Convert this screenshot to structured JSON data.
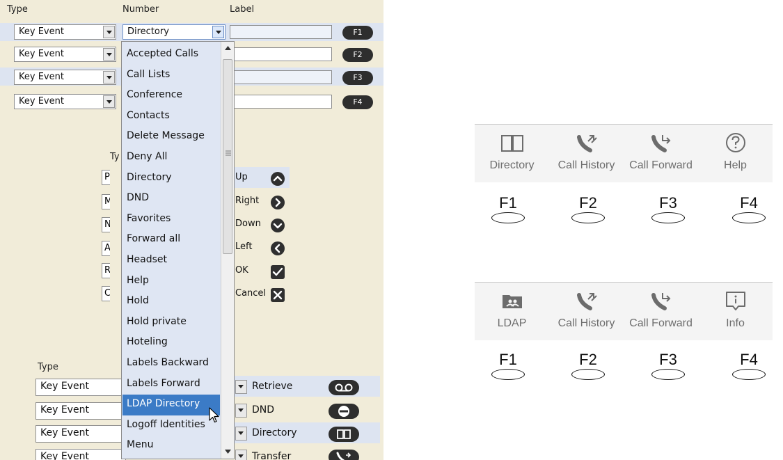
{
  "config": {
    "headers": {
      "type": "Type",
      "number": "Number",
      "label": "Label"
    },
    "top_rows": [
      {
        "type": "Key Event",
        "number": "Directory",
        "fkey": "F1"
      },
      {
        "type": "Key Event",
        "fkey": "F2"
      },
      {
        "type": "Key Event",
        "fkey": "F3"
      },
      {
        "type": "Key Event",
        "fkey": "F4"
      }
    ],
    "nav_section": {
      "type_header_fragment": "Ty",
      "stub_letters": [
        "P",
        "M",
        "N",
        "A",
        "R",
        "C"
      ],
      "labels": [
        "Up",
        "Right",
        "Down",
        "Left",
        "OK",
        "Cancel"
      ],
      "icons": [
        "chevron-up-icon",
        "chevron-right-icon",
        "chevron-down-icon",
        "chevron-left-icon",
        "checkmark-icon",
        "x-mark-icon"
      ]
    },
    "bottom_section": {
      "type_header": "Type",
      "rows": [
        {
          "type": "Key Event",
          "label": "Retrieve",
          "icon": "voicemail-icon"
        },
        {
          "type": "Key Event",
          "label": "DND",
          "icon": "minus-circle-icon"
        },
        {
          "type": "Key Event",
          "label": "Directory",
          "icon": "book-icon"
        },
        {
          "type": "Key Event",
          "label": "Transfer",
          "icon": "phone-forward-icon"
        }
      ]
    },
    "dropdown": {
      "options": [
        "Accepted Calls",
        "Call Lists",
        "Conference",
        "Contacts",
        "Delete Message",
        "Deny All",
        "Directory",
        "DND",
        "Favorites",
        "Forward all",
        "Headset",
        "Help",
        "Hold",
        "Hold private",
        "Hoteling",
        "Labels Backward",
        "Labels Forward",
        "LDAP Directory",
        "Logoff Identities",
        "Menu"
      ],
      "selected": "LDAP Directory"
    }
  },
  "phone": {
    "screen1": {
      "softkeys": [
        {
          "label": "Directory",
          "icon": "book-icon"
        },
        {
          "label": "Call History",
          "icon": "call-history-icon"
        },
        {
          "label": "Call Forward",
          "icon": "call-forward-icon"
        },
        {
          "label": "Help",
          "icon": "help-icon"
        }
      ],
      "fkeys": [
        "F1",
        "F2",
        "F3",
        "F4"
      ]
    },
    "screen2": {
      "softkeys": [
        {
          "label": "LDAP",
          "icon": "ldap-folder-icon"
        },
        {
          "label": "Call History",
          "icon": "call-history-icon"
        },
        {
          "label": "Call Forward",
          "icon": "call-forward-icon"
        },
        {
          "label": "Info",
          "icon": "info-icon"
        }
      ],
      "fkeys": [
        "F1",
        "F2",
        "F3",
        "F4"
      ]
    }
  },
  "colors": {
    "panel_bg": "#f1ecd9",
    "row_highlight": "#dde4f1",
    "dropdown_bg": "#dfe6f3",
    "selection": "#3b7bc6",
    "key_dark": "#2e2e2e",
    "softkey_text": "#6e6e6e"
  }
}
